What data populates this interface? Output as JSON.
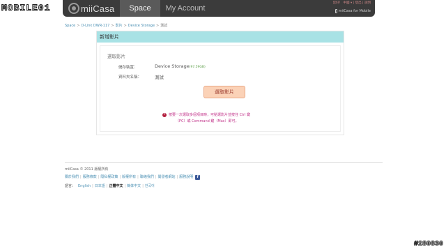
{
  "watermark": {
    "left": "MOBILE01",
    "right": "#280830"
  },
  "header": {
    "logo_text": "miiCasa",
    "tabs": [
      {
        "label": "Space",
        "active": true
      },
      {
        "label": "My Account",
        "active": false
      }
    ],
    "top_links": "您好！ 中國 ▾ | 登出 | 說明",
    "mobile_link": "miiCasa for Mobile"
  },
  "breadcrumb": [
    {
      "label": "Space"
    },
    {
      "label": "D-Link DWR-117"
    },
    {
      "label": "影片"
    },
    {
      "label": "Device Storage"
    },
    {
      "label": "測試"
    }
  ],
  "breadcrumb_separator": ">",
  "panel": {
    "title": "新增影片",
    "section_title": "選取影片",
    "storage_label": "儲存裝置：",
    "storage_value": "Device Storage",
    "storage_size": "(97.59GB)",
    "folder_label": "資料夾名稱：",
    "folder_value": "測試",
    "select_button": "選取影片",
    "notice_line1": "按要一次選取多個項目時，可點選影片並按住 Ctrl 鍵",
    "notice_line2": "（PC）或 Command 鍵（Mac）即可。",
    "notice_icon": "!"
  },
  "footer": {
    "copyright": "miiCasa © 2011   版權所有",
    "links": [
      "關於我們",
      "服務條款",
      "隱私權政策",
      "版權所有",
      "聯絡我們",
      "開發者網站",
      "服務說明"
    ],
    "facebook_icon": "f",
    "language_label": "語言：",
    "languages": [
      "English",
      "日本語",
      "正體中文",
      "簡体中文",
      "한국어"
    ],
    "current_language": "正體中文"
  },
  "colors": {
    "topbar": "#3b3b3b",
    "panel_header": "#a8e2e5",
    "button_bg": "#fbd2b7",
    "link": "#4a8fb3",
    "notice": "#c2348a"
  }
}
